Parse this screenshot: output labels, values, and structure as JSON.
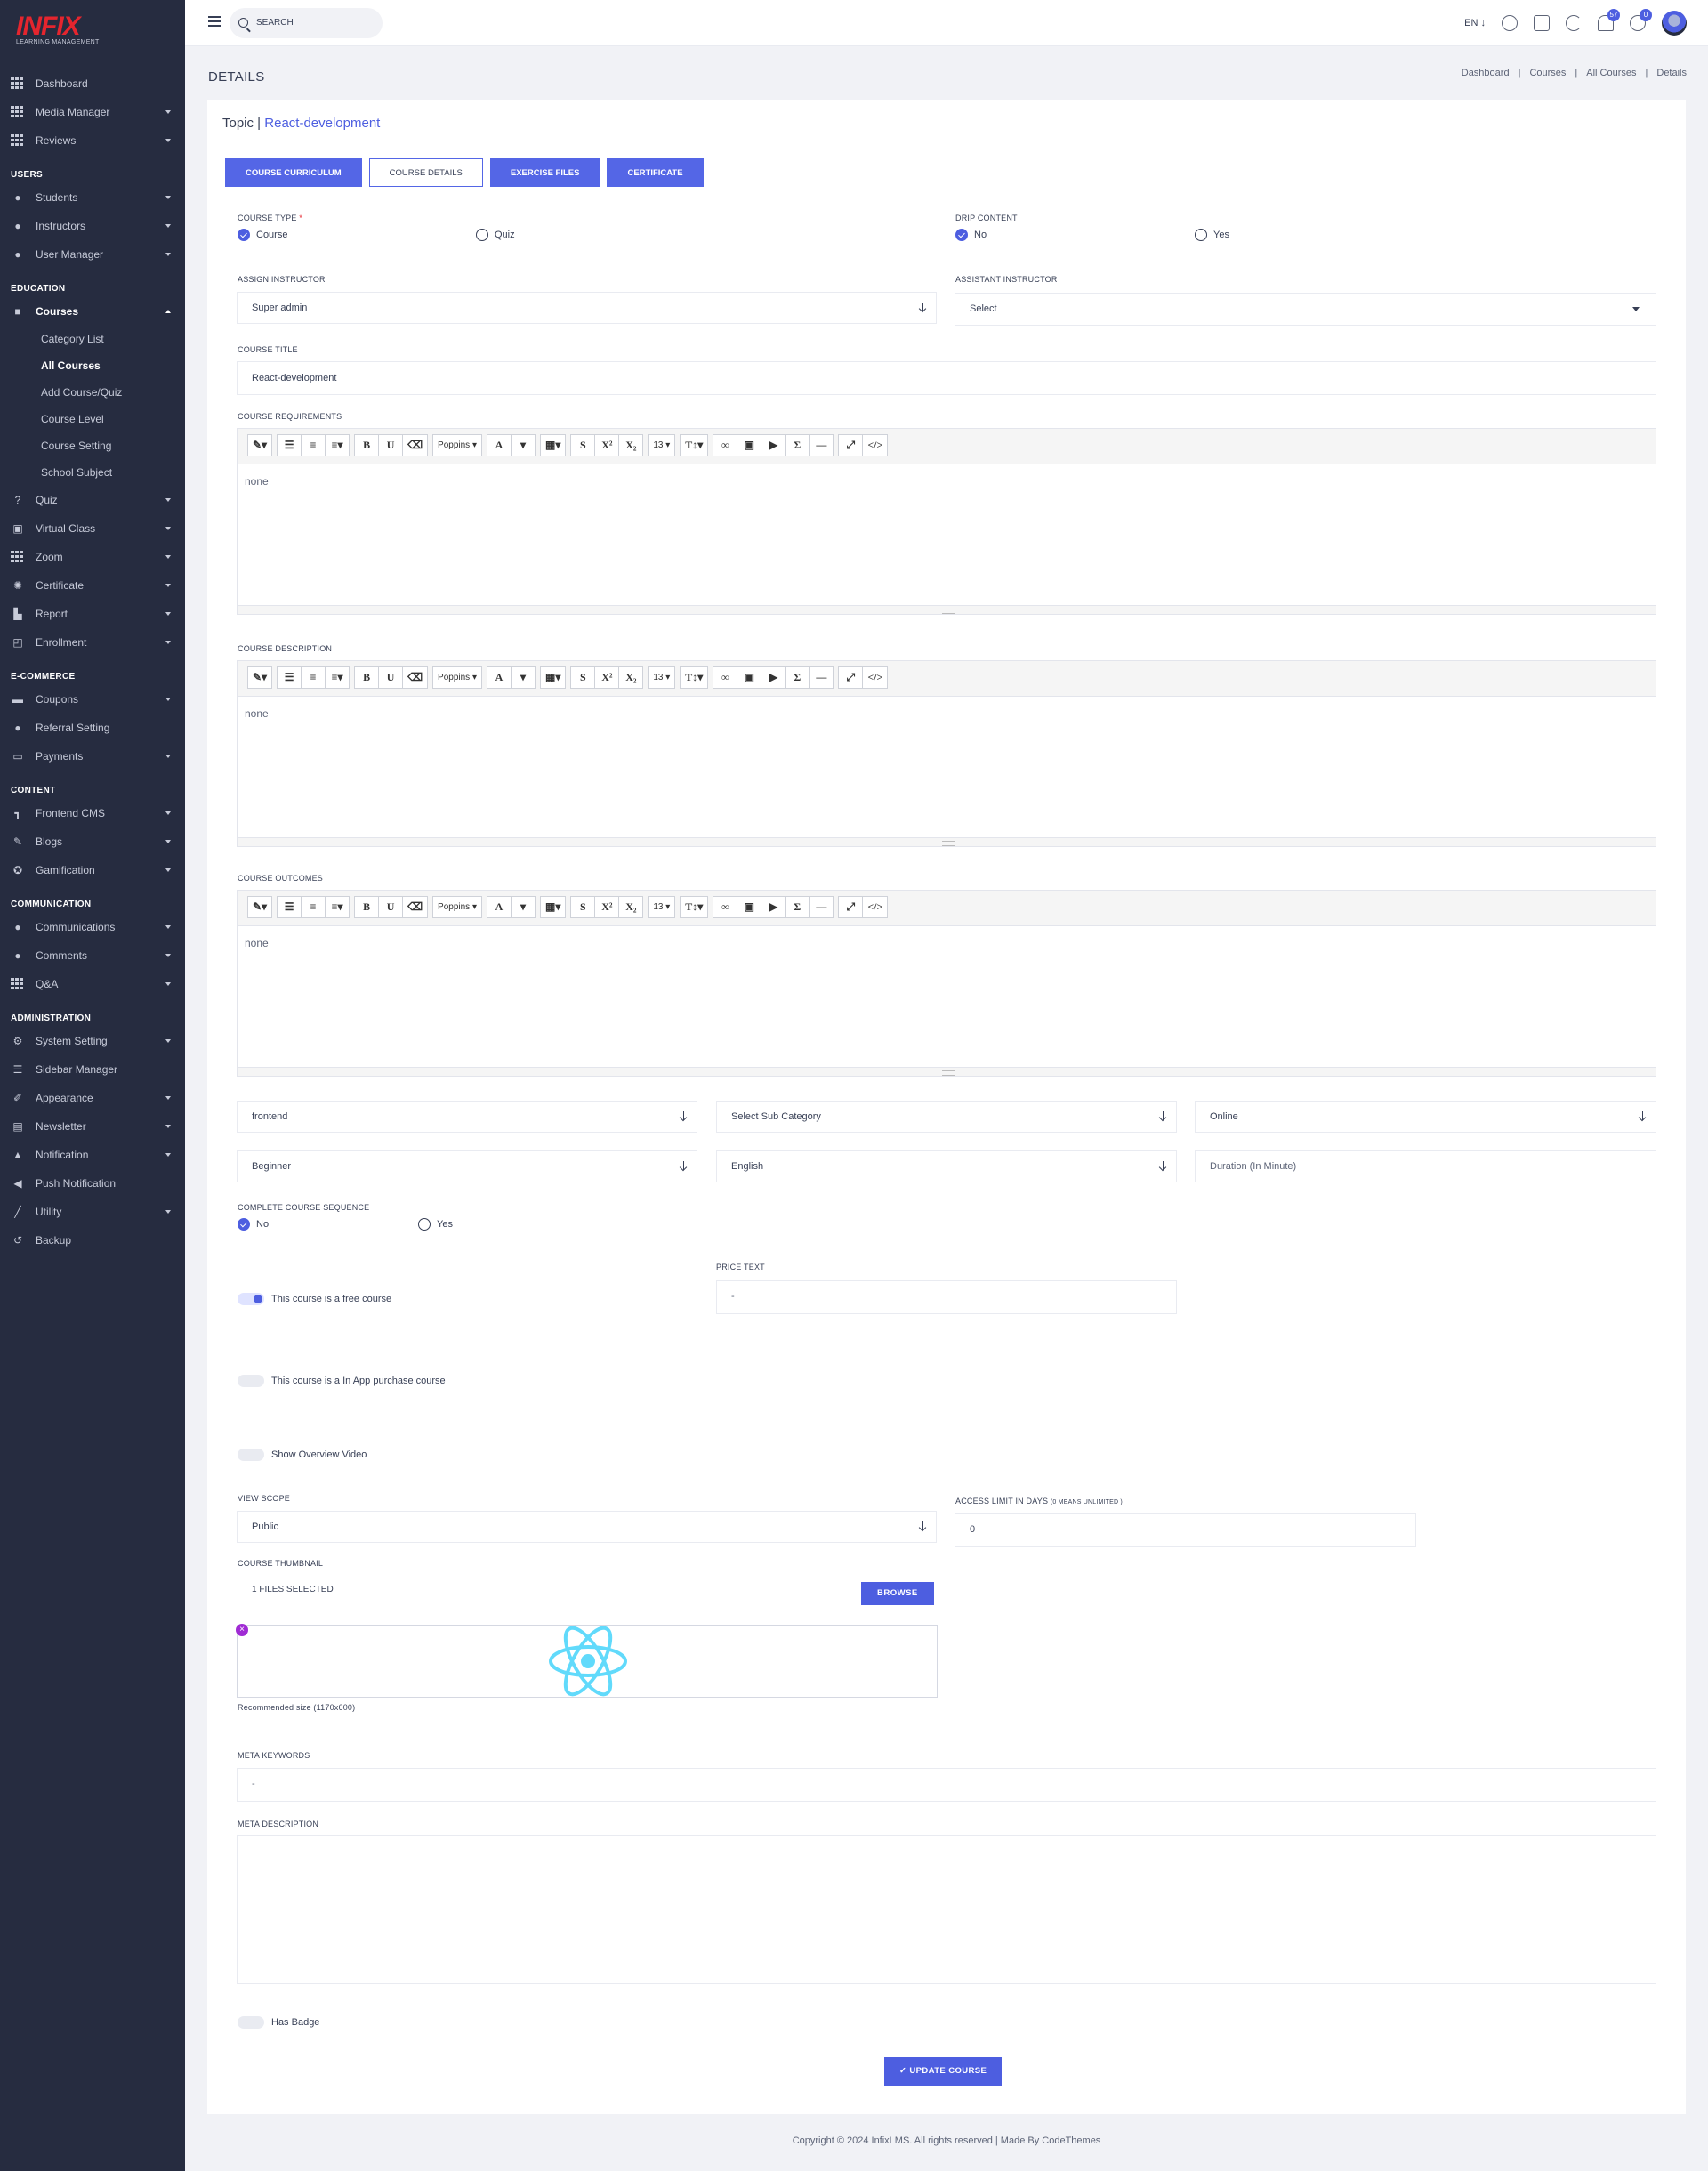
{
  "brand": {
    "logo": "INFIX",
    "tagline": "LEARNING MANAGEMENT",
    "accent": "#4d5ee0",
    "logo_color": "#e5252e"
  },
  "sidebar": {
    "top": [
      {
        "label": "Dashboard",
        "icon": "grid-icon"
      },
      {
        "label": "Media Manager",
        "icon": "grid-icon"
      },
      {
        "label": "Reviews",
        "icon": "grid-icon"
      }
    ],
    "sections": [
      {
        "title": "USERS",
        "items": [
          "Students",
          "Instructors",
          "User Manager"
        ]
      },
      {
        "title": "EDUCATION",
        "items": [
          "Courses",
          "Quiz",
          "Virtual Class",
          "Zoom",
          "Certificate",
          "Report",
          "Enrollment"
        ]
      },
      {
        "title": "E-COMMERCE",
        "items": [
          "Coupons",
          "Referral Setting",
          "Payments"
        ]
      },
      {
        "title": "CONTENT",
        "items": [
          "Frontend CMS",
          "Blogs",
          "Gamification"
        ]
      },
      {
        "title": "COMMUNICATION",
        "items": [
          "Communications",
          "Comments",
          "Q&A"
        ]
      },
      {
        "title": "ADMINISTRATION",
        "items": [
          "System Setting",
          "Sidebar Manager",
          "Appearance",
          "Newsletter",
          "Notification",
          "Push Notification",
          "Utility",
          "Backup"
        ]
      }
    ],
    "courses_sub": [
      "Category List",
      "All Courses",
      "Add Course/Quiz",
      "Course Level",
      "Course Setting",
      "School Subject"
    ]
  },
  "topbar": {
    "search_placeholder": "SEARCH",
    "lang": "EN",
    "notif_count": "57",
    "msg_count": "0"
  },
  "page": {
    "title": "DETAILS",
    "breadcrumbs": [
      "Dashboard",
      "Courses",
      "All Courses",
      "Details"
    ]
  },
  "topic": {
    "prefix": "Topic |",
    "name": "React-development"
  },
  "tabs": [
    "COURSE CURRICULUM",
    "COURSE DETAILS",
    "EXERCISE FILES",
    "CERTIFICATE"
  ],
  "form": {
    "course_type_label": "COURSE TYPE",
    "course_type_opts": [
      "Course",
      "Quiz"
    ],
    "drip_label": "DRIP CONTENT",
    "drip_opts": [
      "No",
      "Yes"
    ],
    "assign_instructor_label": "ASSIGN INSTRUCTOR",
    "assign_instructor_value": "Super admin",
    "assistant_instructor_label": "ASSISTANT INSTRUCTOR",
    "assistant_instructor_value": "Select",
    "course_title_label": "COURSE TITLE",
    "course_title_value": "React-development",
    "requirements_label": "COURSE REQUIREMENTS",
    "requirements_value": "none",
    "description_label": "COURSE DESCRIPTION",
    "description_value": "none",
    "outcomes_label": "COURSE OUTCOMES",
    "outcomes_value": "none",
    "category": "frontend",
    "sub_category": "Select Sub Category",
    "mode": "Online",
    "level": "Beginner",
    "language": "English",
    "duration_placeholder": "Duration   (In Minute)",
    "sequence_label": "COMPLETE COURSE SEQUENCE",
    "sequence_opts": [
      "No",
      "Yes"
    ],
    "price_text_label": "PRICE TEXT",
    "price_text_value": "-",
    "free_course": "This course is a free course",
    "inapp_course": "This course is a In App purchase course",
    "overview_video": "Show Overview Video",
    "view_scope_label": "VIEW SCOPE",
    "view_scope_value": "Public",
    "access_limit_label": "ACCESS LIMIT IN DAYS",
    "access_limit_note": "(0 MEANS UNLIMITED )",
    "access_limit_value": "0",
    "thumbnail_label": "COURSE THUMBNAIL",
    "thumbnail_value": "1 FILES SELECTED",
    "browse": "BROWSE",
    "remove": "×",
    "recommended": "Recommended size (1170x600)",
    "meta_keywords_label": "META KEYWORDS",
    "meta_keywords_value": "-",
    "meta_description_label": "META DESCRIPTION",
    "has_badge": "Has Badge",
    "update": "✓ UPDATE COURSE"
  },
  "editor_toolbar": {
    "font": "Poppins",
    "size": "13"
  },
  "footer": "Copyright © 2024 InfixLMS. All rights reserved | Made By CodeThemes"
}
